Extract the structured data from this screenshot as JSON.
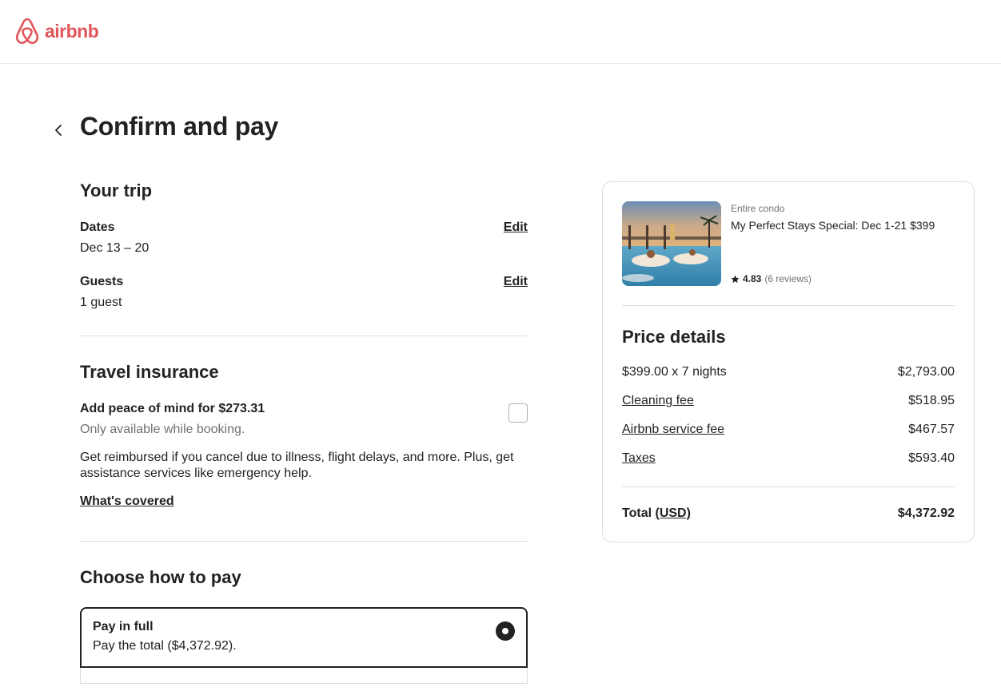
{
  "header": {
    "brand": "airbnb"
  },
  "page": {
    "title": "Confirm and pay"
  },
  "trip": {
    "title": "Your trip",
    "dates_label": "Dates",
    "dates_value": "Dec 13 – 20",
    "guests_label": "Guests",
    "guests_value": "1 guest",
    "edit_label": "Edit"
  },
  "insurance": {
    "title": "Travel insurance",
    "offer": "Add peace of mind for $273.31",
    "note": "Only available while booking.",
    "description": "Get reimbursed if you cancel due to illness, flight delays, and more. Plus, get assistance services like emergency help.",
    "covered_link": "What's covered"
  },
  "payment": {
    "title": "Choose how to pay",
    "option_full_title": "Pay in full",
    "option_full_desc": "Pay the total ($4,372.92)."
  },
  "listing": {
    "type": "Entire condo",
    "name": "My Perfect Stays Special: Dec 1-21 $399",
    "rating": "4.83",
    "reviews": "(6 reviews)"
  },
  "price_details": {
    "title": "Price details",
    "rows": [
      {
        "label": "$399.00 x 7 nights",
        "amount": "$2,793.00"
      },
      {
        "label": "Cleaning fee",
        "amount": "$518.95"
      },
      {
        "label": "Airbnb service fee",
        "amount": "$467.57"
      },
      {
        "label": "Taxes",
        "amount": "$593.40"
      }
    ],
    "total_label": "Total",
    "currency": "(USD)",
    "total_amount": "$4,372.92"
  },
  "colors": {
    "brand": "#e0565b",
    "text": "#222222",
    "muted": "#717171",
    "border": "#dddddd"
  }
}
